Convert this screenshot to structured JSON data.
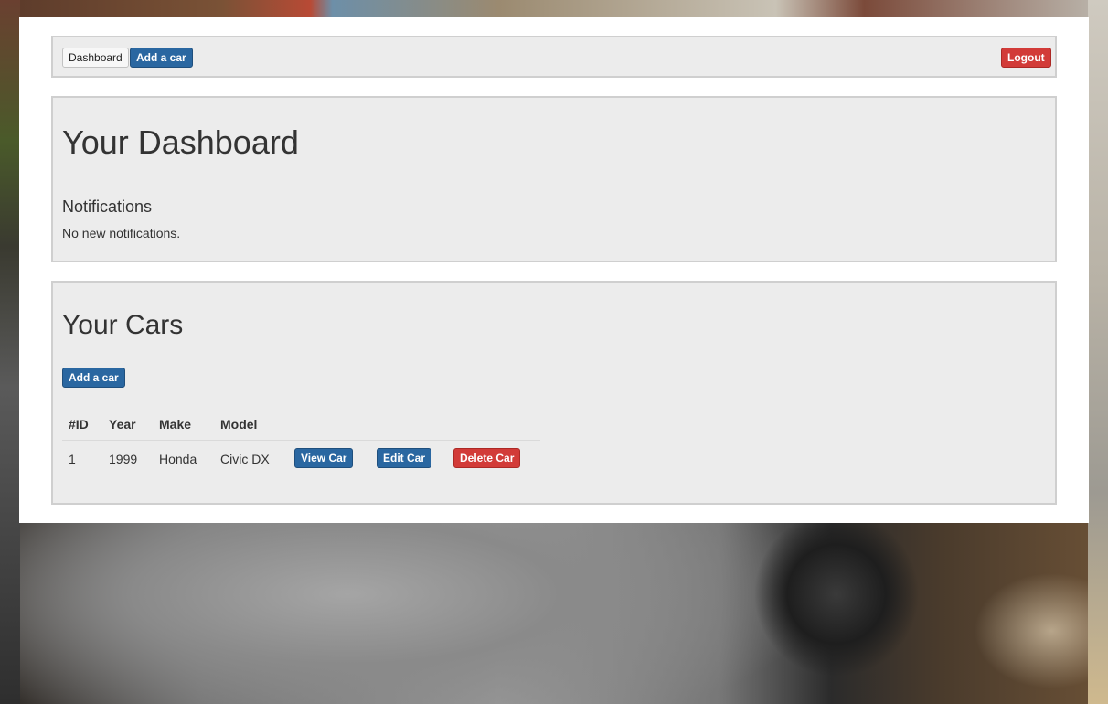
{
  "nav": {
    "dashboard_label": "Dashboard",
    "add_car_label": "Add a car",
    "logout_label": "Logout"
  },
  "dashboard": {
    "title": "Your Dashboard",
    "notifications_heading": "Notifications",
    "notifications_text": "No new notifications."
  },
  "cars": {
    "title": "Your Cars",
    "add_car_label": "Add a car",
    "columns": [
      "#ID",
      "Year",
      "Make",
      "Model"
    ],
    "rows": [
      {
        "id": "1",
        "year": "1999",
        "make": "Honda",
        "model": "Civic DX",
        "view_label": "View Car",
        "edit_label": "Edit Car",
        "delete_label": "Delete Car"
      }
    ]
  },
  "colors": {
    "primary": "#2a67a1",
    "danger": "#d23b38",
    "panel": "#ececec"
  }
}
